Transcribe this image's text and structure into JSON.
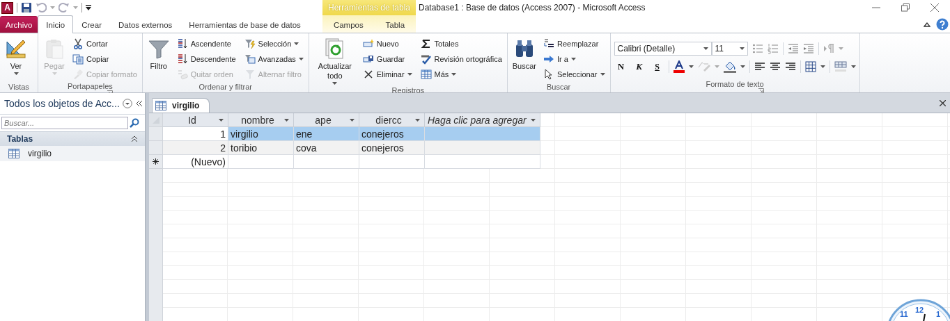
{
  "app_logo": {
    "letter": "A"
  },
  "context_tab_group": {
    "label": "Herramientas de tabla"
  },
  "window": {
    "title": "Database1 : Base de datos (Access 2007)  -  Microsoft Access"
  },
  "tabs": [
    {
      "label": "Archivo",
      "kind": "file",
      "selected": false
    },
    {
      "label": "Inicio",
      "kind": "normal",
      "selected": true
    },
    {
      "label": "Crear",
      "kind": "normal",
      "selected": false
    },
    {
      "label": "Datos externos",
      "kind": "normal",
      "selected": false
    },
    {
      "label": "Herramientas de base de datos",
      "kind": "normal",
      "selected": false
    },
    {
      "label": "Campos",
      "kind": "context",
      "selected": false
    },
    {
      "label": "Tabla",
      "kind": "context",
      "selected": false
    }
  ],
  "ribbon": {
    "groups": [
      {
        "label": "Vistas",
        "kind": "buttons",
        "launcher": false,
        "items": [
          {
            "label": "Ver",
            "kind": "large",
            "disabled": false,
            "dropdown": true
          }
        ]
      },
      {
        "label": "Portapapeles",
        "kind": "buttons",
        "launcher": true,
        "items": [
          {
            "label": "Pegar",
            "kind": "large",
            "disabled": true,
            "dropdown": true
          },
          {
            "label": "Cortar",
            "kind": "small",
            "disabled": false,
            "dropdown": false
          },
          {
            "label": "Copiar",
            "kind": "small",
            "disabled": false,
            "dropdown": false
          },
          {
            "label": "Copiar formato",
            "kind": "small",
            "disabled": true,
            "dropdown": false
          }
        ]
      },
      {
        "label": "Ordenar y filtrar",
        "kind": "buttons",
        "launcher": false,
        "items": [
          {
            "label": "Filtro",
            "kind": "large",
            "disabled": false,
            "dropdown": false
          },
          {
            "label": "Ascendente",
            "kind": "small",
            "disabled": false,
            "dropdown": false
          },
          {
            "label": "Descendente",
            "kind": "small",
            "disabled": false,
            "dropdown": false
          },
          {
            "label": "Quitar orden",
            "kind": "small",
            "disabled": true,
            "dropdown": false
          },
          {
            "label": "Selección",
            "kind": "small",
            "disabled": false,
            "dropdown": true
          },
          {
            "label": "Avanzadas",
            "kind": "small",
            "disabled": false,
            "dropdown": true
          },
          {
            "label": "Alternar filtro",
            "kind": "small",
            "disabled": true,
            "dropdown": false
          }
        ]
      },
      {
        "label": "Registros",
        "kind": "buttons",
        "launcher": false,
        "items": [
          {
            "label": "Actualizar todo",
            "kind": "large",
            "disabled": false,
            "dropdown": true
          },
          {
            "label": "Nuevo",
            "kind": "small",
            "disabled": false,
            "dropdown": false
          },
          {
            "label": "Guardar",
            "kind": "small",
            "disabled": false,
            "dropdown": false
          },
          {
            "label": "Eliminar",
            "kind": "small",
            "disabled": false,
            "dropdown": true
          },
          {
            "label": "Totales",
            "kind": "small",
            "disabled": false,
            "dropdown": false
          },
          {
            "label": "Revisión ortográfica",
            "kind": "small",
            "disabled": false,
            "dropdown": false
          },
          {
            "label": "Más",
            "kind": "small",
            "disabled": false,
            "dropdown": true
          }
        ]
      },
      {
        "label": "Buscar",
        "kind": "buttons",
        "launcher": false,
        "items": [
          {
            "label": "Buscar",
            "kind": "large",
            "disabled": false,
            "dropdown": false
          },
          {
            "label": "Reemplazar",
            "kind": "small",
            "disabled": false,
            "dropdown": false
          },
          {
            "label": "Ir a",
            "kind": "small",
            "disabled": false,
            "dropdown": true
          },
          {
            "label": "Seleccionar",
            "kind": "small",
            "disabled": false,
            "dropdown": true
          }
        ]
      },
      {
        "label": "Formato de texto",
        "kind": "format",
        "launcher": true,
        "font": "Calibri (Detalle)",
        "size": "11",
        "style_buttons": [
          "N",
          "K",
          "S"
        ]
      }
    ]
  },
  "nav_pane": {
    "title": "Todos los objetos de Acc...",
    "search": {
      "placeholder": "Buscar..."
    },
    "sections": [
      {
        "label": "Tablas",
        "expanded": true,
        "items": [
          {
            "label": "virgilio",
            "selected": false
          }
        ]
      }
    ]
  },
  "document_tabs": [
    {
      "label": "virgilio",
      "selected": true
    }
  ],
  "datasheet": {
    "columns": [
      {
        "label": "Id",
        "kind": "field"
      },
      {
        "label": "nombre",
        "kind": "field"
      },
      {
        "label": "ape",
        "kind": "field"
      },
      {
        "label": "diercc",
        "kind": "field"
      },
      {
        "label": "Haga clic para agregar",
        "kind": "add"
      }
    ],
    "rows": [
      {
        "cells": [
          "1",
          "virgilio",
          "ene",
          "conejeros",
          ""
        ],
        "selected": true
      },
      {
        "cells": [
          "2",
          "toribio",
          "cova",
          "conejeros",
          ""
        ],
        "selected": false
      }
    ],
    "new_row": {
      "label": "(Nuevo)"
    }
  },
  "desktop_clock": {
    "numerals": [
      "11",
      "12",
      "1"
    ]
  }
}
